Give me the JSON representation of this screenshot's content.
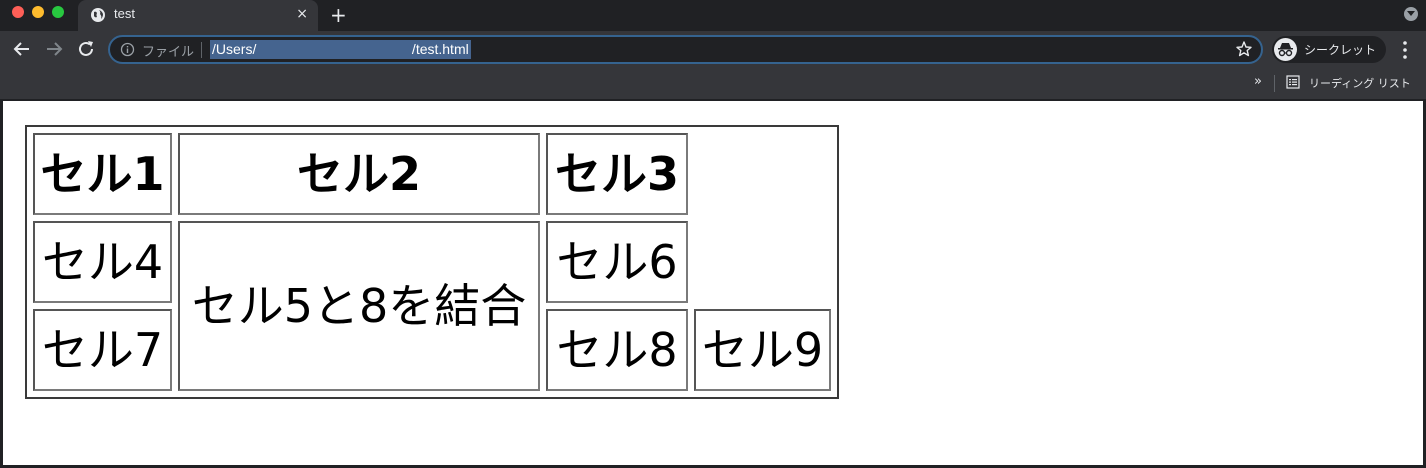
{
  "browser": {
    "tab_title": "test",
    "tab_close_glyph": "×",
    "new_tab_glyph": "+",
    "scheme_label": "ファイル",
    "url": "/Users/                                        /test.html",
    "profile_label": "シークレット",
    "bookmarks_more_glyph": "»",
    "reading_list_label": "リーディング リスト",
    "icons": [
      "globe-icon",
      "close-icon",
      "plus-icon",
      "back-arrow-icon",
      "forward-arrow-icon",
      "reload-icon",
      "info-icon",
      "star-icon",
      "incognito-icon",
      "kebab-menu-icon",
      "reading-list-icon",
      "tab-search-icon"
    ],
    "colors": {
      "omnibox_focus": "#35638f",
      "url_selection": "#45648f"
    }
  },
  "table": {
    "row1": [
      "セル1",
      "セル2",
      "セル3"
    ],
    "row2": [
      "セル4",
      "セル5と8を結合",
      "セル6"
    ],
    "row3": [
      "セル7",
      "セル8",
      "セル9"
    ]
  }
}
